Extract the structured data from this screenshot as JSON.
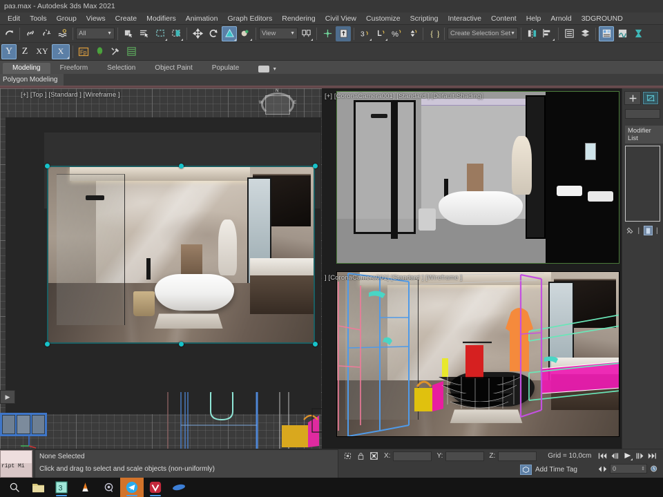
{
  "window": {
    "title": "paз.max - Autodesk 3ds Max 2021"
  },
  "menu": {
    "items": [
      {
        "label": "Edit"
      },
      {
        "label": "Tools"
      },
      {
        "label": "Group"
      },
      {
        "label": "Views"
      },
      {
        "label": "Create"
      },
      {
        "label": "Modifiers"
      },
      {
        "label": "Animation"
      },
      {
        "label": "Graph Editors"
      },
      {
        "label": "Rendering"
      },
      {
        "label": "Civil View"
      },
      {
        "label": "Customize"
      },
      {
        "label": "Scripting"
      },
      {
        "label": "Interactive"
      },
      {
        "label": "Content"
      },
      {
        "label": "Help"
      },
      {
        "label": "Arnold"
      },
      {
        "label": "3DGROUND"
      }
    ]
  },
  "toolbar": {
    "selection_filter": "All",
    "reference_coord": "View",
    "named_selection_sets": "Create Selection Set",
    "row2_buttons": [
      "Y",
      "Z",
      "XY",
      "X"
    ]
  },
  "ribbon": {
    "tabs": [
      {
        "label": "Modeling",
        "selected": true
      },
      {
        "label": "Freeform",
        "selected": false
      },
      {
        "label": "Selection",
        "selected": false
      },
      {
        "label": "Object Paint",
        "selected": false
      },
      {
        "label": "Populate",
        "selected": false
      }
    ],
    "panel_label": "Polygon Modeling"
  },
  "viewports": [
    {
      "name": "top-left",
      "label": "[+] [Top ] [Standard ] [Wireframe ]"
    },
    {
      "name": "top-right",
      "label": "[+] [CoronaCamera001] [Standard ] [Default Shading]"
    },
    {
      "name": "bottom-right",
      "label": "] [CoronaCamera001] [Standard ] [Wireframe ]"
    }
  ],
  "viewcube": {
    "north": "N",
    "west": "W",
    "east": "E"
  },
  "command_panel": {
    "modifier_list_label": "Modifier List"
  },
  "status": {
    "selection": "None Selected",
    "prompt": "Click and drag to select and scale objects (non-uniformly)",
    "listener_text": "ript Mi",
    "coords": {
      "x_label": "X:",
      "x_value": "",
      "y_label": "Y:",
      "y_value": "",
      "z_label": "Z:",
      "z_value": ""
    },
    "grid": "Grid = 10,0cm",
    "add_time_tag": "Add Time Tag",
    "current_frame": "0"
  },
  "taskbar": {
    "items": [
      {
        "name": "search",
        "glyph": "⌕"
      },
      {
        "name": "file-explorer",
        "glyph": "🗀"
      },
      {
        "name": "app-3",
        "glyph": "3"
      },
      {
        "name": "vlc",
        "glyph": "▲"
      },
      {
        "name": "app-purple",
        "glyph": "◎"
      },
      {
        "name": "telegram",
        "glyph": "➤"
      },
      {
        "name": "vivaldi",
        "glyph": "V"
      },
      {
        "name": "app-blue-pill",
        "glyph": "⬭"
      }
    ]
  },
  "colors": {
    "accent": "#17c2c9",
    "highlight": "#5b7fa6",
    "taskbar_active": "#d2732a"
  }
}
